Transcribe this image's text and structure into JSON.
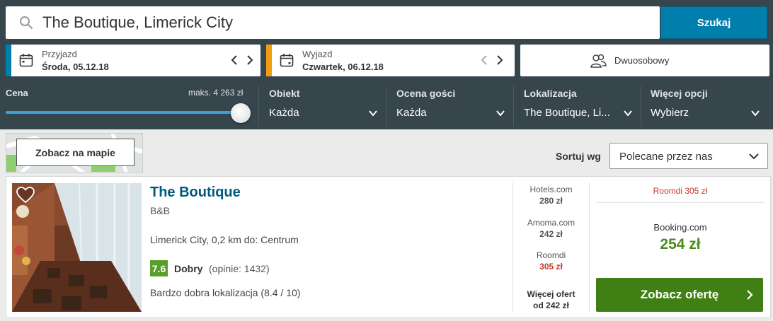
{
  "search": {
    "query": "The Boutique, Limerick City",
    "button_label": "Szukaj"
  },
  "checkin": {
    "label": "Przyjazd",
    "value": "Środa, 05.12.18",
    "accent_color": "#007fad"
  },
  "checkout": {
    "label": "Wyjazd",
    "value": "Czwartek, 06.12.18",
    "accent_color": "#f39c12"
  },
  "room": {
    "value": "Dwuosobowy"
  },
  "filters": {
    "price": {
      "title": "Cena",
      "max_label": "maks. 4 263 zł"
    },
    "property": {
      "title": "Obiekt",
      "value": "Każda"
    },
    "rating": {
      "title": "Ocena gości",
      "value": "Każda"
    },
    "location": {
      "title": "Lokalizacja",
      "value": "The Boutique, Li..."
    },
    "more": {
      "title": "Więcej opcji",
      "value": "Wybierz"
    }
  },
  "map": {
    "button_label": "Zobacz na mapie"
  },
  "sort": {
    "label": "Sortuj wg",
    "value": "Polecane przez nas"
  },
  "hotel": {
    "name": "The Boutique",
    "type": "B&B",
    "location": "Limerick City, 0,2 km do: Centrum",
    "rating_score": "7.6",
    "rating_word": "Dobry",
    "rating_count": "(opinie: 1432)",
    "extra": "Bardzo dobra lokalizacja (8.4 / 10)",
    "rating_color": "#5a9e2a"
  },
  "offers": [
    {
      "site": "Hotels.com",
      "price": "280 zł"
    },
    {
      "site": "Amoma.com",
      "price": "242 zł"
    },
    {
      "site": "Roomdi",
      "price": "305 zł"
    }
  ],
  "more_offers": {
    "line1": "Więcej ofert",
    "line2": "od 242 zł"
  },
  "best_offer": {
    "top_deal": "Roomdi 305 zł",
    "site": "Booking.com",
    "price": "254 zł",
    "button_label": "Zobacz ofertę",
    "button_color": "#3f7f14"
  }
}
